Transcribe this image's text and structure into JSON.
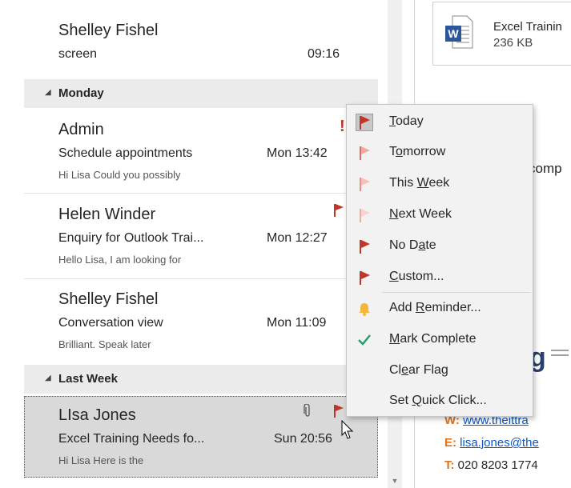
{
  "messages_top": {
    "sender": "Shelley Fishel",
    "subject": "screen",
    "time": "09:16"
  },
  "group_monday": "Monday",
  "msg_admin": {
    "sender": "Admin",
    "subject": "Schedule appointments",
    "time": "Mon 13:42",
    "preview": "Hi Lisa  Could you possibly",
    "importance": "!"
  },
  "msg_helen": {
    "sender": "Helen Winder",
    "subject": "Enquiry for Outlook Trai...",
    "time": "Mon 12:27",
    "preview": "Hello Lisa,  I am looking for"
  },
  "msg_shelley": {
    "sender": "Shelley Fishel",
    "subject": "Conversation view",
    "time": "Mon 11:09",
    "preview": "Brilliant.  Speak later"
  },
  "group_lastweek": "Last Week",
  "msg_lisa": {
    "sender": "LIsa Jones",
    "subject": "Excel Training Needs fo...",
    "time": "Sun 20:56",
    "preview": "Hi Lisa  Here is the"
  },
  "menu": {
    "today": {
      "pre": "",
      "u": "T",
      "post": "oday"
    },
    "tomorrow": {
      "pre": "T",
      "u": "o",
      "post": "morrow"
    },
    "thisweek": {
      "pre": "This ",
      "u": "W",
      "post": "eek"
    },
    "nextweek": {
      "pre": "",
      "u": "N",
      "post": "ext Week"
    },
    "nodate": {
      "pre": "No D",
      "u": "a",
      "post": "te"
    },
    "custom": {
      "pre": "",
      "u": "C",
      "post": "ustom..."
    },
    "reminder": {
      "pre": "Add ",
      "u": "R",
      "post": "eminder..."
    },
    "complete": {
      "pre": "",
      "u": "M",
      "post": "ark Complete"
    },
    "clear": {
      "pre": "Cl",
      "u": "e",
      "post": "ar Flag"
    },
    "quick": {
      "pre": "Set ",
      "u": "Q",
      "post": "uick Click..."
    }
  },
  "reading": {
    "attachment_name": "Excel Trainin",
    "attachment_size": "236 KB",
    "body_fragment": "comp",
    "logo_fragment": "g",
    "w_label": "W:",
    "w_value": "www.theittra",
    "e_label": "E:",
    "e_value": "lisa.jones@the",
    "t_label": "T:",
    "t_value": "020 8203 1774"
  },
  "colors": {
    "flag": "#c2362a",
    "flag_light": "#f4b6ae",
    "bell": "#f5b63b",
    "check": "#2e9a6e",
    "accent": "#e0731c",
    "link": "#0b57c9"
  }
}
